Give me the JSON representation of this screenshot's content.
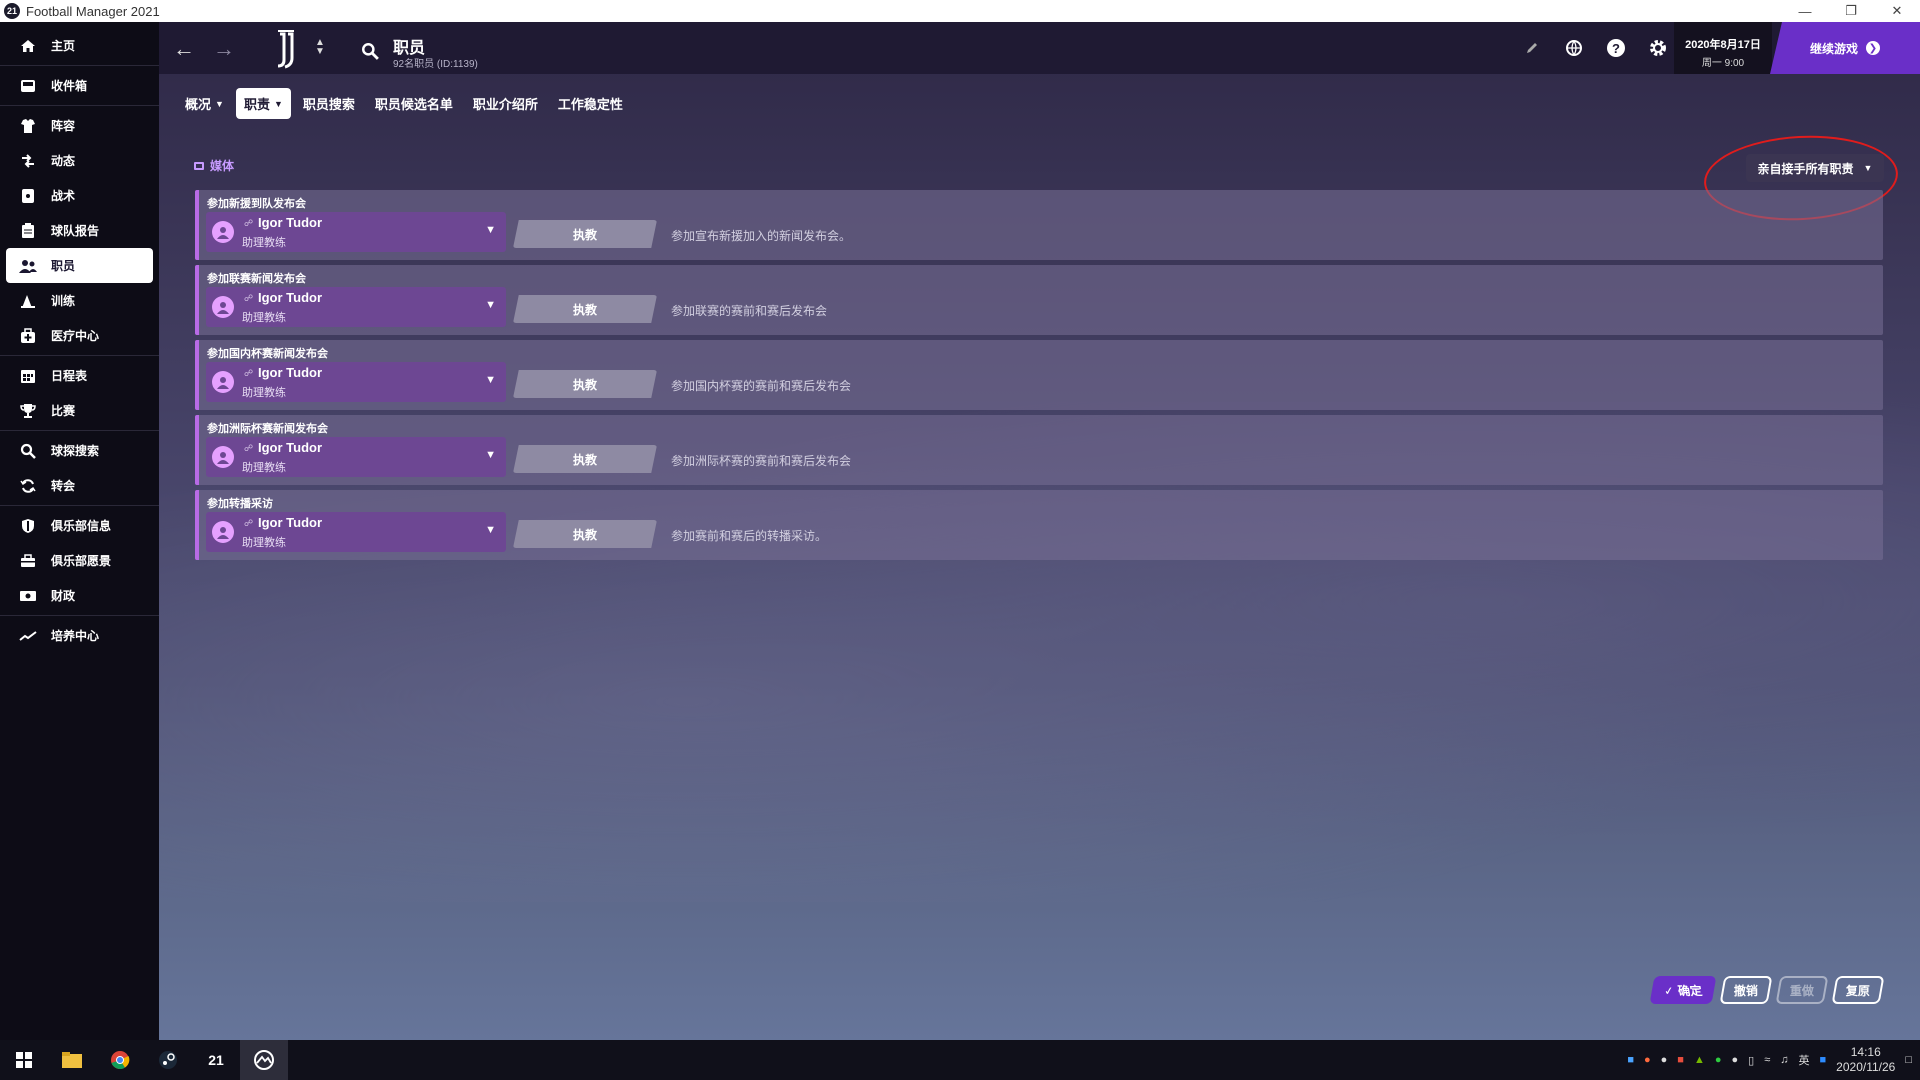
{
  "window": {
    "title": "Football Manager 2021",
    "app_icon_text": "21"
  },
  "sidebar": {
    "items": [
      {
        "label": "主页",
        "icon": "home-icon"
      },
      {
        "label": "收件箱",
        "icon": "inbox-icon"
      },
      {
        "label": "阵容",
        "icon": "squad-icon"
      },
      {
        "label": "动态",
        "icon": "dynamics-icon"
      },
      {
        "label": "战术",
        "icon": "tactics-icon"
      },
      {
        "label": "球队报告",
        "icon": "report-icon"
      },
      {
        "label": "职员",
        "icon": "staff-icon"
      },
      {
        "label": "训练",
        "icon": "training-icon"
      },
      {
        "label": "医疗中心",
        "icon": "medical-icon"
      },
      {
        "label": "日程表",
        "icon": "calendar-icon"
      },
      {
        "label": "比赛",
        "icon": "trophy-icon"
      },
      {
        "label": "球探搜索",
        "icon": "search-icon"
      },
      {
        "label": "转会",
        "icon": "transfer-icon"
      },
      {
        "label": "俱乐部信息",
        "icon": "shield-icon"
      },
      {
        "label": "俱乐部愿景",
        "icon": "vision-icon"
      },
      {
        "label": "财政",
        "icon": "finance-icon"
      },
      {
        "label": "培养中心",
        "icon": "development-icon"
      }
    ],
    "active_index": 6
  },
  "header": {
    "title": "职员",
    "subtitle": "92名职员 (ID:1139)",
    "date": "2020年8月17日",
    "day_time": "周一 9:00",
    "continue_label": "继续游戏"
  },
  "tabs": [
    {
      "label": "概况",
      "dropdown": true
    },
    {
      "label": "职责",
      "dropdown": true,
      "active": true
    },
    {
      "label": "职员搜索"
    },
    {
      "label": "职员候选名单"
    },
    {
      "label": "职业介绍所"
    },
    {
      "label": "工作稳定性"
    }
  ],
  "section": {
    "label": "媒体"
  },
  "takeover_button": {
    "label": "亲自接手所有职责"
  },
  "duties": [
    {
      "title": "参加新援到队发布会",
      "staff": "Igor Tudor",
      "role": "助理教练",
      "action": "执教",
      "description": "参加宣布新援加入的新闻发布会。"
    },
    {
      "title": "参加联赛新闻发布会",
      "staff": "Igor Tudor",
      "role": "助理教练",
      "action": "执教",
      "description": "参加联赛的赛前和赛后发布会"
    },
    {
      "title": "参加国内杯赛新闻发布会",
      "staff": "Igor Tudor",
      "role": "助理教练",
      "action": "执教",
      "description": "参加国内杯赛的赛前和赛后发布会"
    },
    {
      "title": "参加洲际杯赛新闻发布会",
      "staff": "Igor Tudor",
      "role": "助理教练",
      "action": "执教",
      "description": "参加洲际杯赛的赛前和赛后发布会"
    },
    {
      "title": "参加转播采访",
      "staff": "Igor Tudor",
      "role": "助理教练",
      "action": "执教",
      "description": "参加赛前和赛后的转播采访。"
    }
  ],
  "actions": {
    "confirm": "确定",
    "undo": "撤销",
    "redo": "重做",
    "reset": "复原"
  },
  "taskbar": {
    "time": "14:16",
    "date": "2020/11/26",
    "ime": "英",
    "fm_label": "21"
  },
  "colors": {
    "accent": "#6a2fc8",
    "section_label": "#c79bff",
    "duty_border": "#b86be6",
    "annotation": "#e01c1c"
  }
}
